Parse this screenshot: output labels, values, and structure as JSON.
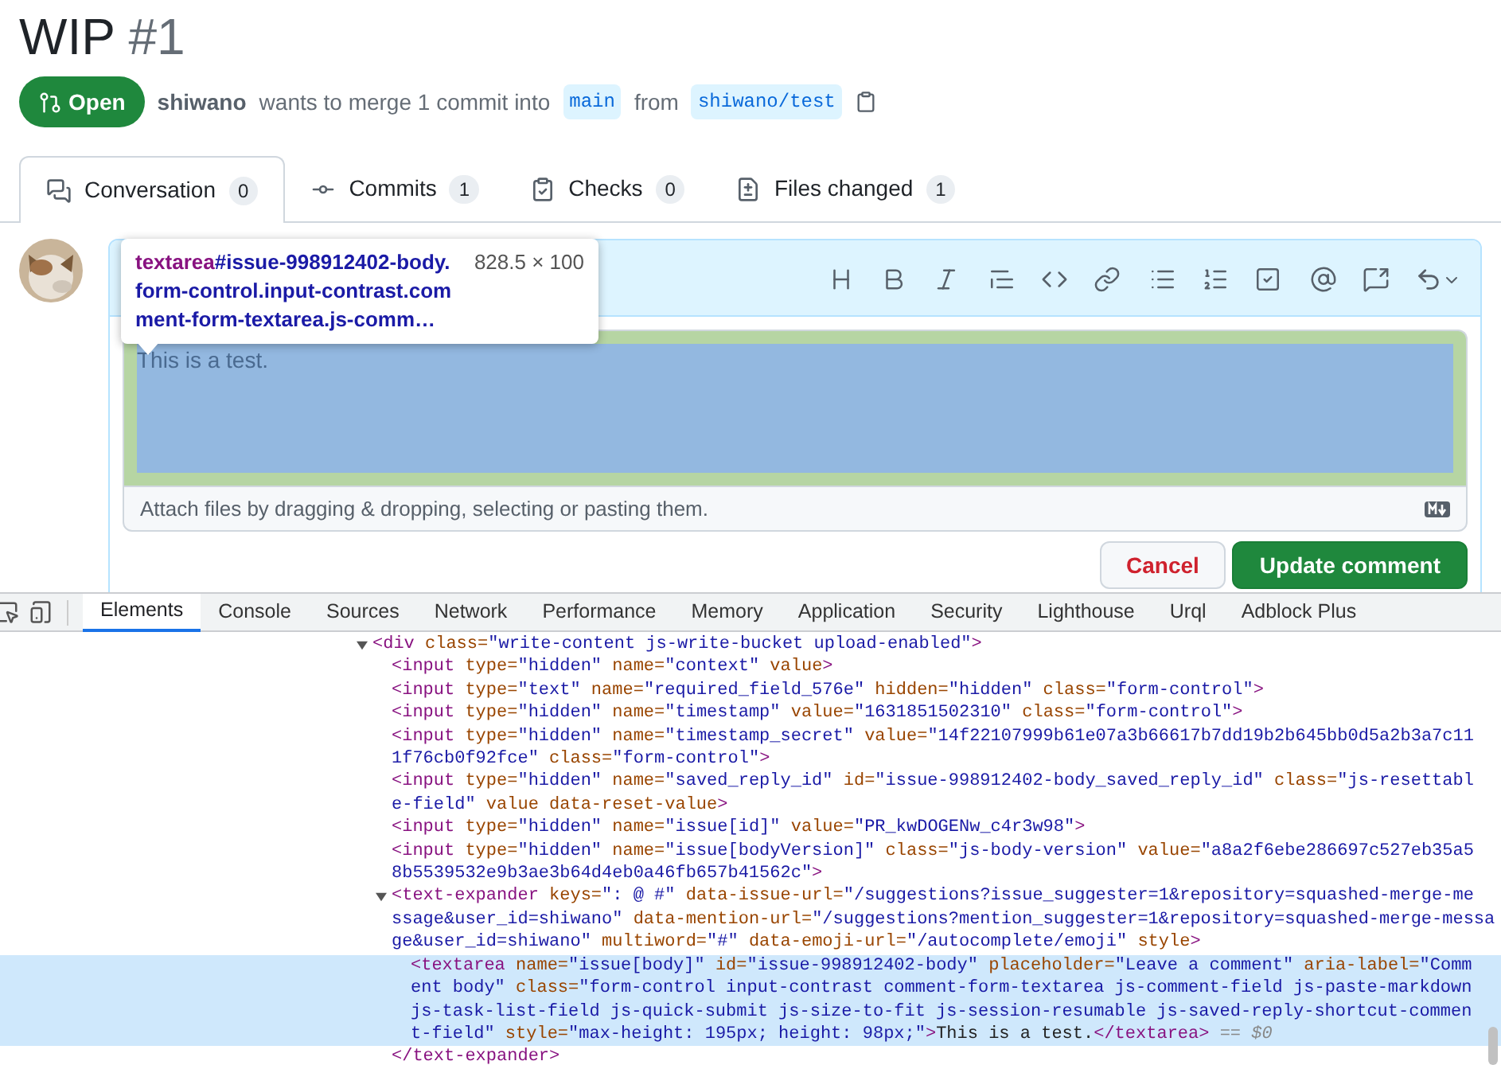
{
  "title": {
    "text": "WIP",
    "number": "#1"
  },
  "status": {
    "label": "Open"
  },
  "summary": {
    "author": "shiwano",
    "text": "wants to merge 1 commit into",
    "base": "main",
    "joiner": "from",
    "head": "shiwano/test"
  },
  "tabs": [
    {
      "label": "Conversation",
      "count": "0",
      "selected": true,
      "kind": "conversation"
    },
    {
      "label": "Commits",
      "count": "1",
      "selected": false,
      "kind": "commits"
    },
    {
      "label": "Checks",
      "count": "0",
      "selected": false,
      "kind": "checks"
    },
    {
      "label": "Files changed",
      "count": "1",
      "selected": false,
      "kind": "files"
    }
  ],
  "editor": {
    "value": "This is a test.",
    "hint": "Attach files by dragging & dropping, selecting or pasting them.",
    "highlighted": true
  },
  "buttons": [
    {
      "label": "Cancel",
      "kind": "secondary"
    },
    {
      "label": "Update comment",
      "kind": "primary"
    }
  ],
  "inspect_tooltip": {
    "tag": "textarea",
    "selector": "#issue-998912402-body.form-control.input-contrast.comment-form-textarea.js-comm…",
    "size": "828.5 × 100"
  },
  "devtools": {
    "tabs": [
      {
        "label": "Elements",
        "selected": true
      },
      {
        "label": "Console",
        "selected": false
      },
      {
        "label": "Sources",
        "selected": false
      },
      {
        "label": "Network",
        "selected": false
      },
      {
        "label": "Performance",
        "selected": false
      },
      {
        "label": "Memory",
        "selected": false
      },
      {
        "label": "Application",
        "selected": false
      },
      {
        "label": "Security",
        "selected": false
      },
      {
        "label": "Lighthouse",
        "selected": false
      },
      {
        "label": "Urql",
        "selected": false
      },
      {
        "label": "Adblock Plus",
        "selected": false
      }
    ],
    "tree": [
      {
        "expanded": true,
        "selected": false,
        "lines": [
          [
            {
              "kind": "tag",
              "text": "<div"
            },
            {
              "kind": "attr",
              "text": " class="
            },
            {
              "kind": "value",
              "text": "\"write-content js-write-bucket upload-enabled\""
            },
            {
              "kind": "tag",
              "text": ">"
            }
          ]
        ],
        "children": [
          {
            "selected": false,
            "lines": [
              [
                {
                  "kind": "tag",
                  "text": "<input"
                },
                {
                  "kind": "attr",
                  "text": " type="
                },
                {
                  "kind": "value",
                  "text": "\"hidden\""
                },
                {
                  "kind": "attr",
                  "text": " name="
                },
                {
                  "kind": "value",
                  "text": "\"context\""
                },
                {
                  "kind": "attr",
                  "text": " value"
                },
                {
                  "kind": "tag",
                  "text": ">"
                }
              ]
            ]
          },
          {
            "selected": false,
            "lines": [
              [
                {
                  "kind": "tag",
                  "text": "<input"
                },
                {
                  "kind": "attr",
                  "text": " type="
                },
                {
                  "kind": "value",
                  "text": "\"text\""
                },
                {
                  "kind": "attr",
                  "text": " name="
                },
                {
                  "kind": "value",
                  "text": "\"required_field_576e\""
                },
                {
                  "kind": "attr",
                  "text": " hidden="
                },
                {
                  "kind": "value",
                  "text": "\"hidden\""
                },
                {
                  "kind": "attr",
                  "text": " class="
                },
                {
                  "kind": "value",
                  "text": "\"form-control\""
                },
                {
                  "kind": "tag",
                  "text": ">"
                }
              ]
            ]
          },
          {
            "selected": false,
            "lines": [
              [
                {
                  "kind": "tag",
                  "text": "<input"
                },
                {
                  "kind": "attr",
                  "text": " type="
                },
                {
                  "kind": "value",
                  "text": "\"hidden\""
                },
                {
                  "kind": "attr",
                  "text": " name="
                },
                {
                  "kind": "value",
                  "text": "\"timestamp\""
                },
                {
                  "kind": "attr",
                  "text": " value="
                },
                {
                  "kind": "value",
                  "text": "\"1631851502310\""
                },
                {
                  "kind": "attr",
                  "text": " class="
                },
                {
                  "kind": "value",
                  "text": "\"form-control\""
                },
                {
                  "kind": "tag",
                  "text": ">"
                }
              ]
            ]
          },
          {
            "selected": false,
            "lines": [
              [
                {
                  "kind": "tag",
                  "text": "<input"
                },
                {
                  "kind": "attr",
                  "text": " type="
                },
                {
                  "kind": "value",
                  "text": "\"hidden\""
                },
                {
                  "kind": "attr",
                  "text": " name="
                },
                {
                  "kind": "value",
                  "text": "\"timestamp_secret\""
                },
                {
                  "kind": "attr",
                  "text": " value="
                },
                {
                  "kind": "value",
                  "text": "\"14f22107999b61e07a3b66617b7dd19b2b645bb0d5a2b3a7c11"
                }
              ],
              [
                {
                  "kind": "value",
                  "text": "1f76cb0f92fce\""
                },
                {
                  "kind": "attr",
                  "text": " class="
                },
                {
                  "kind": "value",
                  "text": "\"form-control\""
                },
                {
                  "kind": "tag",
                  "text": ">"
                }
              ]
            ]
          },
          {
            "selected": false,
            "lines": [
              [
                {
                  "kind": "tag",
                  "text": "<input"
                },
                {
                  "kind": "attr",
                  "text": " type="
                },
                {
                  "kind": "value",
                  "text": "\"hidden\""
                },
                {
                  "kind": "attr",
                  "text": " name="
                },
                {
                  "kind": "value",
                  "text": "\"saved_reply_id\""
                },
                {
                  "kind": "attr",
                  "text": " id="
                },
                {
                  "kind": "value",
                  "text": "\"issue-998912402-body_saved_reply_id\""
                },
                {
                  "kind": "attr",
                  "text": " class="
                },
                {
                  "kind": "value",
                  "text": "\"js-resettabl"
                }
              ],
              [
                {
                  "kind": "value",
                  "text": "e-field\""
                },
                {
                  "kind": "attr",
                  "text": " value data-reset-value"
                },
                {
                  "kind": "tag",
                  "text": ">"
                }
              ]
            ]
          },
          {
            "selected": false,
            "lines": [
              [
                {
                  "kind": "tag",
                  "text": "<input"
                },
                {
                  "kind": "attr",
                  "text": " type="
                },
                {
                  "kind": "value",
                  "text": "\"hidden\""
                },
                {
                  "kind": "attr",
                  "text": " name="
                },
                {
                  "kind": "value",
                  "text": "\"issue[id]\""
                },
                {
                  "kind": "attr",
                  "text": " value="
                },
                {
                  "kind": "value",
                  "text": "\"PR_kwDOGENw_c4r3w98\""
                },
                {
                  "kind": "tag",
                  "text": ">"
                }
              ]
            ]
          },
          {
            "selected": false,
            "lines": [
              [
                {
                  "kind": "tag",
                  "text": "<input"
                },
                {
                  "kind": "attr",
                  "text": " type="
                },
                {
                  "kind": "value",
                  "text": "\"hidden\""
                },
                {
                  "kind": "attr",
                  "text": " name="
                },
                {
                  "kind": "value",
                  "text": "\"issue[bodyVersion]\""
                },
                {
                  "kind": "attr",
                  "text": " class="
                },
                {
                  "kind": "value",
                  "text": "\"js-body-version\""
                },
                {
                  "kind": "attr",
                  "text": " value="
                },
                {
                  "kind": "value",
                  "text": "\"a8a2f6ebe286697c527eb35a5"
                }
              ],
              [
                {
                  "kind": "value",
                  "text": "8b5539532e9b3ae3b64d4eb0a46fb657b41562c\""
                },
                {
                  "kind": "tag",
                  "text": ">"
                }
              ]
            ]
          },
          {
            "expanded": true,
            "selected": false,
            "lines": [
              [
                {
                  "kind": "tag",
                  "text": "<text-expander"
                },
                {
                  "kind": "attr",
                  "text": " keys="
                },
                {
                  "kind": "value",
                  "text": "\": @ #\""
                },
                {
                  "kind": "attr",
                  "text": " data-issue-url="
                },
                {
                  "kind": "value",
                  "text": "\"/suggestions?issue_suggester=1&repository=squashed-merge-me"
                }
              ],
              [
                {
                  "kind": "value",
                  "text": "ssage&user_id=shiwano\""
                },
                {
                  "kind": "attr",
                  "text": " data-mention-url="
                },
                {
                  "kind": "value",
                  "text": "\"/suggestions?mention_suggester=1&repository=squashed-merge-messa"
                }
              ],
              [
                {
                  "kind": "value",
                  "text": "ge&user_id=shiwano\""
                },
                {
                  "kind": "attr",
                  "text": " multiword="
                },
                {
                  "kind": "value",
                  "text": "\"#\""
                },
                {
                  "kind": "attr",
                  "text": " data-emoji-url="
                },
                {
                  "kind": "value",
                  "text": "\"/autocomplete/emoji\""
                },
                {
                  "kind": "attr",
                  "text": " style"
                },
                {
                  "kind": "tag",
                  "text": ">"
                }
              ]
            ],
            "children": [
              {
                "selected": true,
                "lines": [
                  [
                    {
                      "kind": "tag",
                      "text": "<textarea"
                    },
                    {
                      "kind": "attr",
                      "text": " name="
                    },
                    {
                      "kind": "value",
                      "text": "\"issue[body]\""
                    },
                    {
                      "kind": "attr",
                      "text": " id="
                    },
                    {
                      "kind": "value",
                      "text": "\"issue-998912402-body\""
                    },
                    {
                      "kind": "attr",
                      "text": " placeholder="
                    },
                    {
                      "kind": "value",
                      "text": "\"Leave a comment\""
                    },
                    {
                      "kind": "attr",
                      "text": " aria-label="
                    },
                    {
                      "kind": "value",
                      "text": "\"Comm"
                    }
                  ],
                  [
                    {
                      "kind": "value",
                      "text": "ent body\""
                    },
                    {
                      "kind": "attr",
                      "text": " class="
                    },
                    {
                      "kind": "value",
                      "text": "\"form-control input-contrast comment-form-textarea js-comment-field js-paste-markdown"
                    }
                  ],
                  [
                    {
                      "kind": "value",
                      "text": "js-task-list-field js-quick-submit js-size-to-fit js-session-resumable js-saved-reply-shortcut-commen"
                    }
                  ],
                  [
                    {
                      "kind": "value",
                      "text": "t-field\""
                    },
                    {
                      "kind": "attr",
                      "text": " style="
                    },
                    {
                      "kind": "value",
                      "text": "\"max-height: 195px; height: 98px;\""
                    },
                    {
                      "kind": "tag",
                      "text": ">"
                    },
                    {
                      "kind": "text",
                      "text": "This is a test."
                    },
                    {
                      "kind": "tag",
                      "text": "</textarea>"
                    },
                    {
                      "kind": "suffix",
                      "text": " == $0"
                    }
                  ]
                ]
              }
            ],
            "closing": [
              {
                "kind": "tag",
                "text": "</text-expander>"
              }
            ]
          }
        ]
      }
    ]
  }
}
